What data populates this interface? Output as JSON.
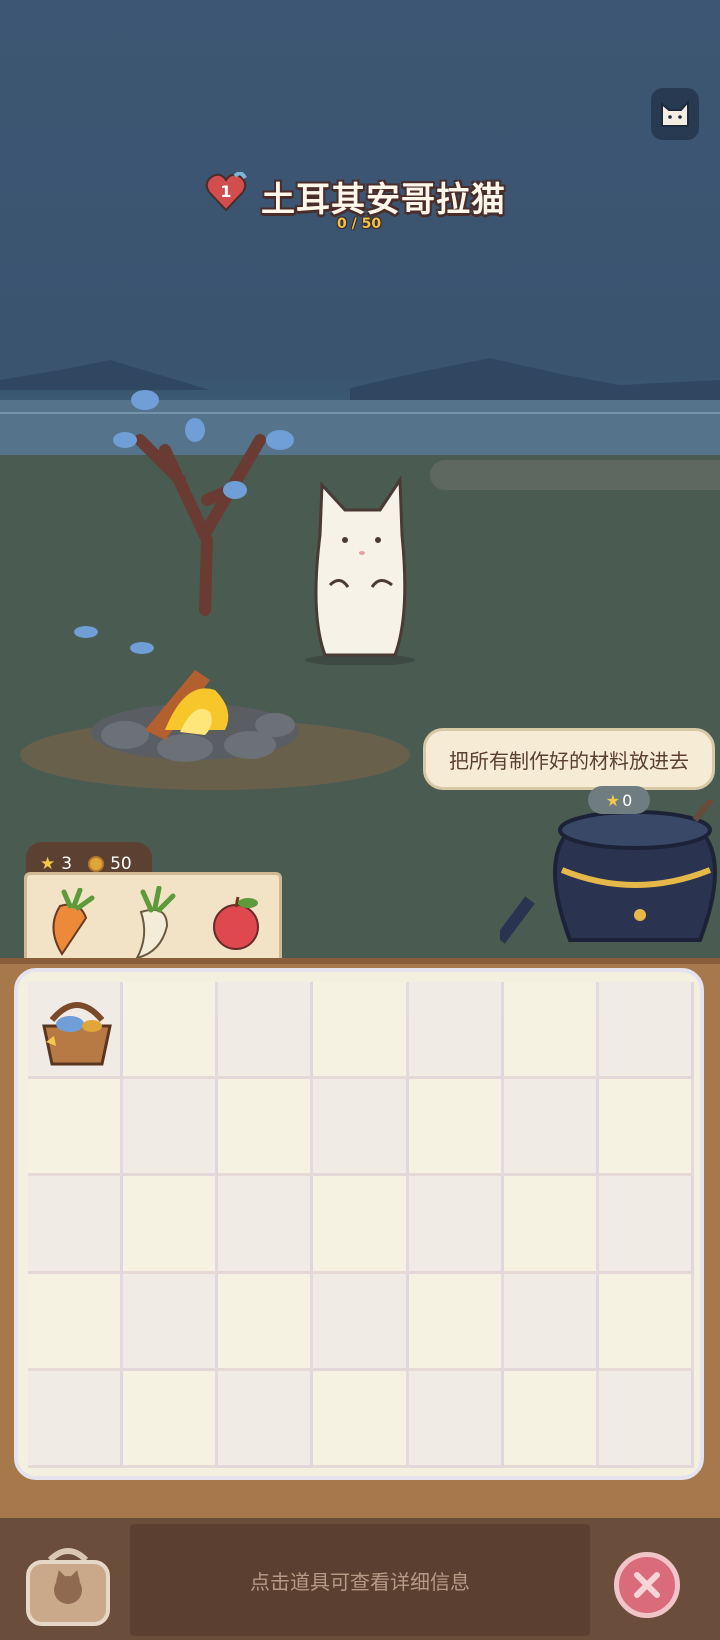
{
  "header": {
    "level": "1",
    "cat_name": "土耳其安哥拉猫",
    "progress": "0 / 50"
  },
  "speech_bubble": "把所有制作好的材料放进去",
  "pot": {
    "stars": "0"
  },
  "currency": {
    "stars": "3",
    "coins": "50"
  },
  "ingredients": [
    {
      "icon": "carrot-icon"
    },
    {
      "icon": "radish-icon"
    },
    {
      "icon": "apple-icon"
    }
  ],
  "inventory": {
    "columns": 7,
    "rows": 5,
    "items": [
      {
        "icon": "basket-icon"
      }
    ]
  },
  "bottom": {
    "hint": "点击道具可查看详细信息"
  },
  "colors": {
    "sky": "#3c5673",
    "board": "#a7784c",
    "panel": "#f4f0df",
    "close": "#d96b7b"
  }
}
